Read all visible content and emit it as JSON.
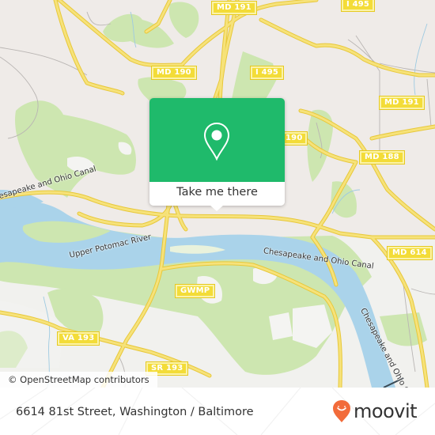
{
  "map": {
    "attribution": "© OpenStreetMap contributors",
    "colors": {
      "land": "#efebe8",
      "park": "#cde6b0",
      "water": "#aad3ea",
      "road": "#f6e27a",
      "road_edge": "#e8c83a",
      "minor_road": "#b9b5b3"
    },
    "shields": [
      {
        "label": "MD 191",
        "id": "md-191-north"
      },
      {
        "label": "I 495",
        "id": "i-495-top"
      },
      {
        "label": "MD 190",
        "id": "md-190-west"
      },
      {
        "label": "I 495",
        "id": "i-495-mid"
      },
      {
        "label": "MD 191",
        "id": "md-191-east"
      },
      {
        "label": "190",
        "id": "md-190-east"
      },
      {
        "label": "MD 188",
        "id": "md-188"
      },
      {
        "label": "MD 614",
        "id": "md-614"
      },
      {
        "label": "GWMP",
        "id": "gwmp"
      },
      {
        "label": "VA 193",
        "id": "va-193"
      },
      {
        "label": "SR 193",
        "id": "sr-193"
      }
    ],
    "labels": {
      "canal_west": "Chesapeake and Ohio Canal",
      "river": "Upper Potomac River",
      "canal_center": "Chesapeake and Ohio Canal",
      "canal_east": "Chesapeake and Ohio Canal"
    }
  },
  "popup": {
    "icon": "location-pin-icon",
    "button_label": "Take me there",
    "color": "#1fba6b"
  },
  "footer": {
    "address": "6614 81st Street, Washington / Baltimore",
    "brand": "moovit",
    "brand_color": "#f26b3a"
  }
}
